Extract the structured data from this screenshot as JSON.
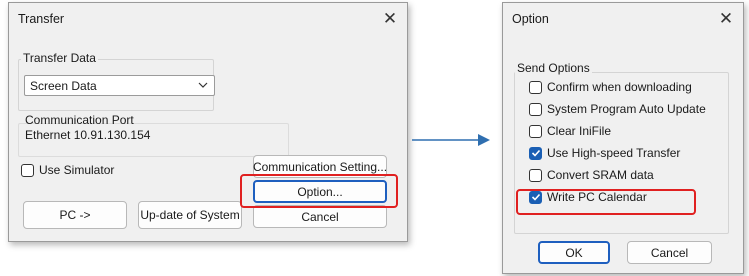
{
  "transfer_dialog": {
    "title": "Transfer",
    "close_glyph": "✕",
    "transfer_data_group": {
      "label": "Transfer Data",
      "combo_value": "Screen Data"
    },
    "communication_port": {
      "label": "Communication Port",
      "value": "Ethernet 10.91.130.154"
    },
    "use_simulator": {
      "label": "Use Simulator",
      "checked": false
    },
    "buttons": {
      "communication_setting": "Communication Setting...",
      "option": "Option...",
      "cancel": "Cancel",
      "pc": "PC ->",
      "update_system": "Up-date of System"
    }
  },
  "option_dialog": {
    "title": "Option",
    "close_glyph": "✕",
    "send_options": {
      "label": "Send Options",
      "items": [
        {
          "label": "Confirm when downloading",
          "checked": false
        },
        {
          "label": "System Program Auto Update",
          "checked": false
        },
        {
          "label": "Clear IniFile",
          "checked": false
        },
        {
          "label": "Use High-speed Transfer",
          "checked": true
        },
        {
          "label": "Convert SRAM data",
          "checked": false
        },
        {
          "label": "Write PC Calendar",
          "checked": true
        }
      ]
    },
    "buttons": {
      "ok": "OK",
      "cancel": "Cancel"
    }
  },
  "annotations": {
    "highlight_color": "#e02020",
    "arrow_color": "#2f6fb0"
  },
  "icons": {
    "close": "close-icon",
    "dropdown": "chevron-down-icon",
    "checkmark": "checkmark-icon",
    "arrow": "right-arrow-icon"
  }
}
